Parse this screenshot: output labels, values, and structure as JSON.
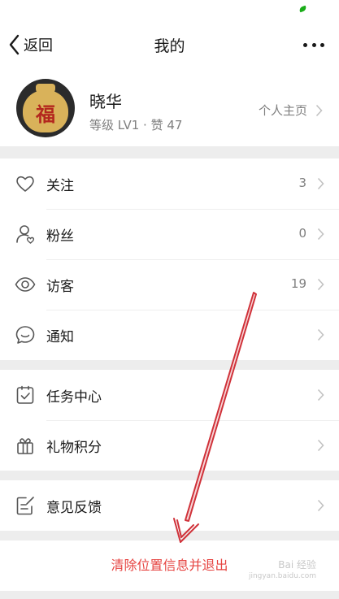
{
  "nav": {
    "back_label": "返回",
    "title": "我的",
    "more_icon": "more-dots-icon"
  },
  "profile": {
    "name": "晓华",
    "level": "等级 LV1 · 赞 47",
    "homepage_label": "个人主页",
    "avatar_text": "福"
  },
  "groups": [
    [
      {
        "icon": "heart-icon",
        "label": "关注",
        "count": "3"
      },
      {
        "icon": "fans-icon",
        "label": "粉丝",
        "count": "0"
      },
      {
        "icon": "eye-icon",
        "label": "访客",
        "count": "19"
      },
      {
        "icon": "message-icon",
        "label": "通知",
        "count": ""
      }
    ],
    [
      {
        "icon": "task-icon",
        "label": "任务中心",
        "count": ""
      },
      {
        "icon": "gift-icon",
        "label": "礼物积分",
        "count": ""
      }
    ],
    [
      {
        "icon": "feedback-icon",
        "label": "意见反馈",
        "count": ""
      }
    ]
  ],
  "logout_label": "清除位置信息并退出",
  "watermark": {
    "brand": "Bai 经验",
    "site": "jingyan.baidu.com"
  },
  "colors": {
    "accent_red": "#e64340",
    "annotation_red": "#d0323a",
    "text_gray": "#7f7f7f",
    "background": "#ededed"
  }
}
